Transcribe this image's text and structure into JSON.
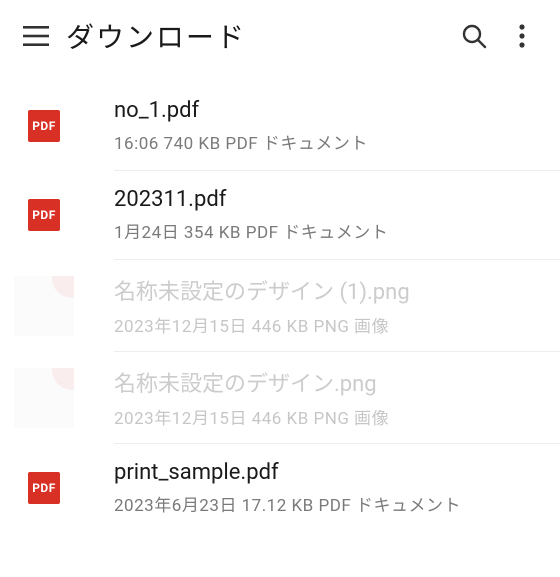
{
  "header": {
    "title": "ダウンロード"
  },
  "files": [
    {
      "name": "no_1.pdf",
      "meta": "16:06 740 KB PDF ドキュメント",
      "type": "pdf",
      "faded": false
    },
    {
      "name": "202311.pdf",
      "meta": "1月24日 354 KB PDF ドキュメント",
      "type": "pdf",
      "faded": false
    },
    {
      "name": "名称未設定のデザイン (1).png",
      "meta": "2023年12月15日 446 KB PNG 画像",
      "type": "png",
      "faded": true
    },
    {
      "name": "名称未設定のデザイン.png",
      "meta": "2023年12月15日 446 KB PNG 画像",
      "type": "png",
      "faded": true
    },
    {
      "name": "print_sample.pdf",
      "meta": "2023年6月23日 17.12 KB PDF ドキュメント",
      "type": "pdf",
      "faded": false
    }
  ],
  "icons": {
    "pdf_badge_text": "PDF"
  }
}
